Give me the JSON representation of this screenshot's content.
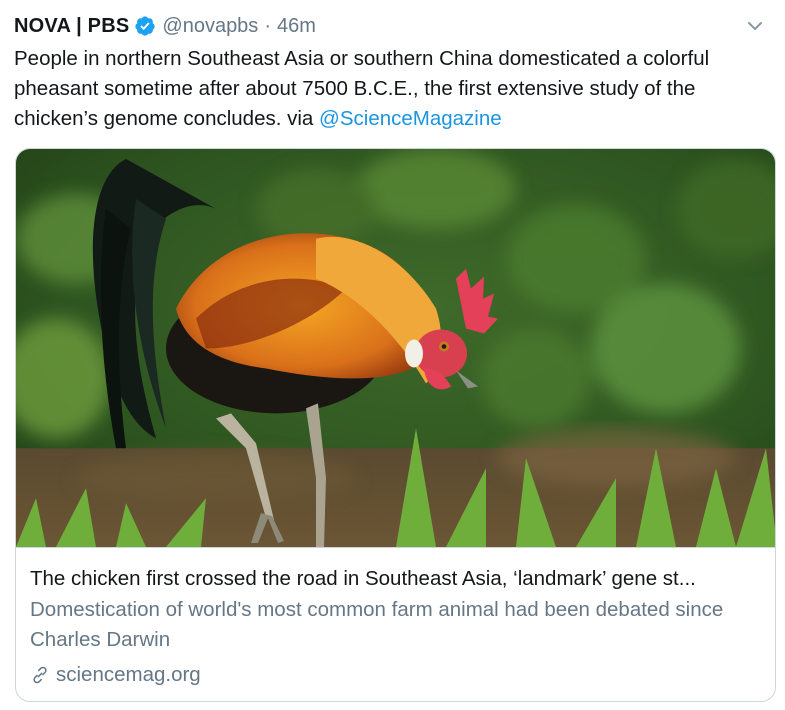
{
  "tweet": {
    "display_name": "NOVA | PBS",
    "verified_icon": "verified-badge-icon",
    "handle": "@novapbs",
    "separator": "·",
    "timestamp": "46m",
    "menu_icon": "chevron-down-icon",
    "text_before_mention": "People in northern Southeast Asia or southern China domesticated a colorful pheasant sometime after about 7500 B.C.E., the first extensive study of the chicken’s genome concludes. via ",
    "mention": "@ScienceMagazine"
  },
  "card": {
    "image_subject": "rooster-photo",
    "title": "The chicken first crossed the road in Southeast Asia, ‘landmark’ gene st...",
    "description": "Domestication of world's most common farm animal had been debated since Charles Darwin",
    "domain_icon": "link-icon",
    "domain": "sciencemag.org"
  },
  "colors": {
    "accent": "#1b95e0",
    "text": "#14171a",
    "secondary": "#657786",
    "border": "#ccd6dd"
  }
}
